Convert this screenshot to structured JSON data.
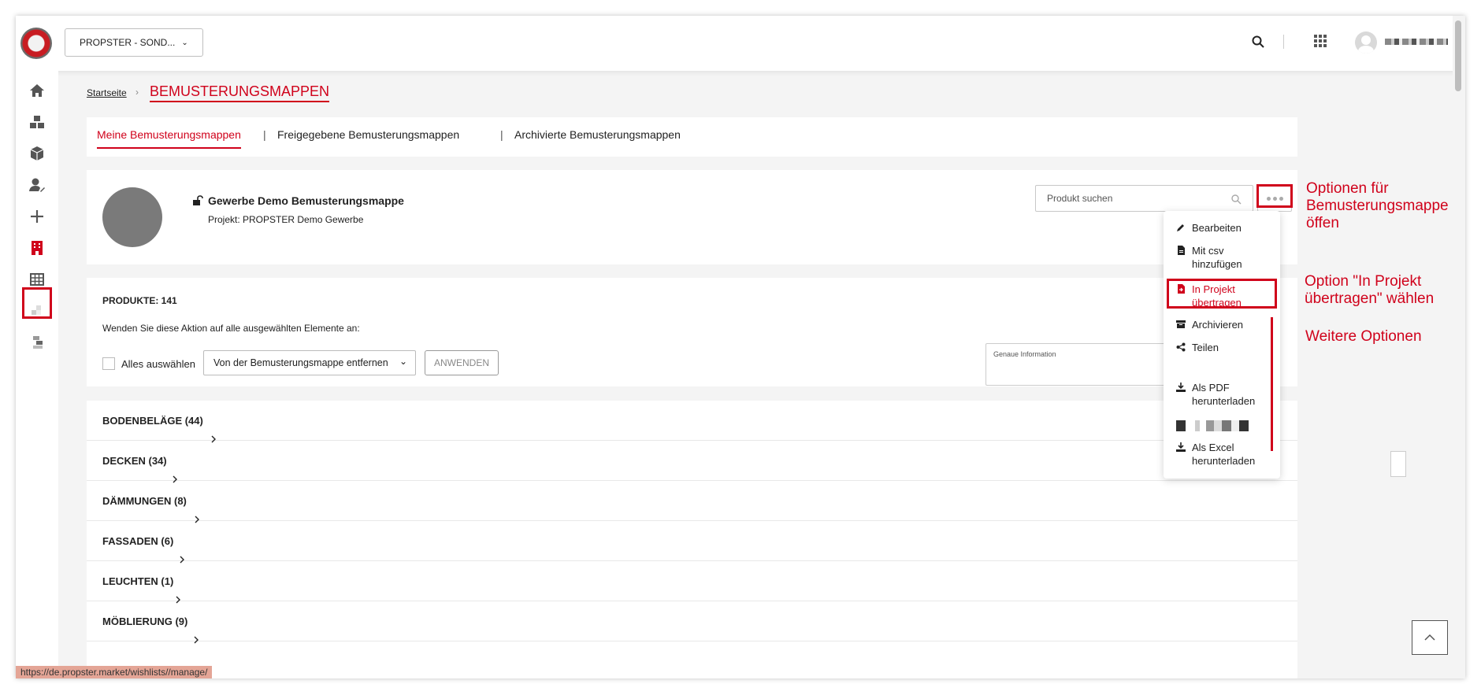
{
  "header": {
    "project_select": "PROPSTER - SOND..."
  },
  "breadcrumb": {
    "home": "Startseite",
    "current": "BEMUSTERUNGSMAPPEN"
  },
  "tabs": [
    {
      "label": "Meine Bemusterungsmappen",
      "active": true
    },
    {
      "label": "Freigegebene Bemusterungsmappen",
      "active": false
    },
    {
      "label": "Archivierte Bemusterungsmappen",
      "active": false
    }
  ],
  "tab_separator": "|",
  "wishlist": {
    "title": "Gewerbe Demo Bemusterungsmappe",
    "project": "Projekt: PROPSTER Demo Gewerbe",
    "search_placeholder": "Produkt suchen"
  },
  "products": {
    "count_label": "PRODUKTE: 141",
    "bulk_hint": "Wenden Sie diese Aktion auf alle ausgewählten Elemente an:",
    "select_all": "Alles auswählen",
    "action_selected": "Von der Bemusterungsmappe entfernen",
    "apply_button": "ANWENDEN",
    "info_label": "Genaue Information"
  },
  "categories": [
    "BODENBELÄGE (44)",
    "DECKEN (34)",
    "DÄMMUNGEN (8)",
    "FASSADEN (6)",
    "LEUCHTEN (1)",
    "MÖBLIERUNG (9)"
  ],
  "dropdown": {
    "edit": "Bearbeiten",
    "csv_line1": "Mit csv",
    "csv_line2": "hinzufügen",
    "transfer_line1": "In Projekt",
    "transfer_line2": "übertragen",
    "archive": "Archivieren",
    "share": "Teilen",
    "pdf_line1": "Als PDF",
    "pdf_line2": "herunterladen",
    "excel_line1": "Als Excel",
    "excel_line2": "herunterladen"
  },
  "annotations": {
    "open_options_1": "Optionen für",
    "open_options_2": "Bemusterungsmappe",
    "open_options_3": "öffen",
    "choose_option_1": "Option \"In Projekt",
    "choose_option_2": "übertragen\" wählen",
    "more_options": "Weitere Optionen"
  },
  "status_url": "https://de.propster.market/wishlists//manage/",
  "colors": {
    "accent": "#d0021b",
    "background": "#f4f4f4"
  },
  "icons": [
    "home-icon",
    "cubes-icon",
    "box-icon",
    "user-edit-icon",
    "plus-icon",
    "building-icon",
    "table-icon",
    "search-icon",
    "apps-grid-icon",
    "lock-open-icon",
    "pencil-icon",
    "file-csv-icon",
    "file-transfer-icon",
    "archive-icon",
    "share-icon",
    "download-icon",
    "chevron-up-icon"
  ]
}
